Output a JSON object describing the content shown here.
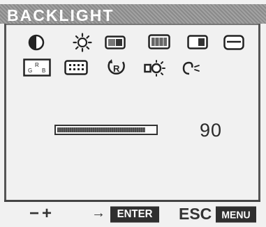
{
  "header": {
    "title": "BACKLIGHT"
  },
  "icons_row1": [
    {
      "name": "contrast-icon"
    },
    {
      "name": "brightness-icon"
    },
    {
      "name": "position-icon"
    },
    {
      "name": "size-icon"
    },
    {
      "name": "display-icon"
    },
    {
      "name": "monitor-icon"
    }
  ],
  "icons_row2": [
    {
      "name": "color-rgb-icon",
      "label": "G R B"
    },
    {
      "name": "osd-icon"
    },
    {
      "name": "reset-icon",
      "label": "R"
    },
    {
      "name": "backlight-icon"
    },
    {
      "name": "audio-icon"
    }
  ],
  "slider": {
    "level_percent": 90
  },
  "value_text": "90",
  "footer": {
    "adjust": "−+",
    "arrow": "→",
    "enter": "ENTER",
    "esc": "ESC",
    "menu": "MENU"
  }
}
